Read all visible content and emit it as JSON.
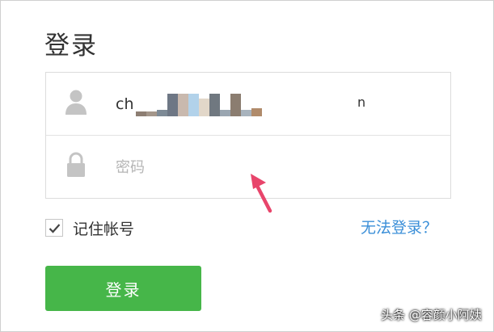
{
  "login": {
    "title": "登录",
    "username": {
      "prefix": "ch",
      "suffix": "n",
      "icon": "user-icon"
    },
    "password": {
      "placeholder": "密码",
      "icon": "lock-icon"
    },
    "remember": {
      "label": "记住帐号",
      "checked": true
    },
    "forgot_label": "无法登录？",
    "submit_label": "登录"
  },
  "watermark": "头条 @容颜小阿姨",
  "colors": {
    "primary_button": "#46b649",
    "link": "#3b8fd8",
    "arrow": "#e8456b"
  }
}
